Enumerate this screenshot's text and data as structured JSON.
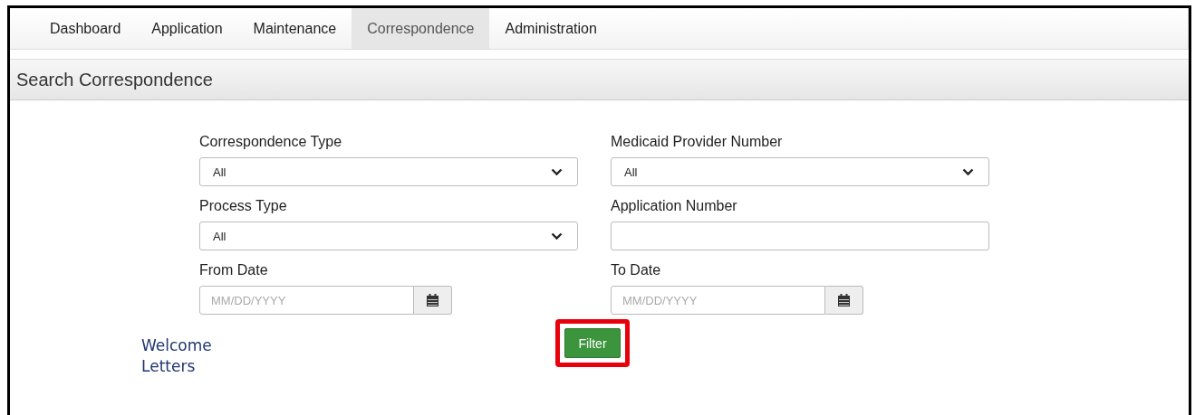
{
  "tabs": [
    {
      "label": "Dashboard",
      "selected": false
    },
    {
      "label": "Application",
      "selected": false
    },
    {
      "label": "Maintenance",
      "selected": false
    },
    {
      "label": "Correspondence",
      "selected": true
    },
    {
      "label": "Administration",
      "selected": false
    }
  ],
  "panel": {
    "title": "Search Correspondence"
  },
  "fields": [
    {
      "kind": "select",
      "label": "Correspondence Type",
      "value": "All"
    },
    {
      "kind": "select",
      "label": "Medicaid Provider Number",
      "value": "All"
    },
    {
      "kind": "select",
      "label": "Process Type",
      "value": "All"
    },
    {
      "kind": "text",
      "label": "Application Number"
    },
    {
      "kind": "date",
      "label": "From Date",
      "placeholder": "MM/DD/YYYY"
    },
    {
      "kind": "date",
      "label": "To Date",
      "placeholder": "MM/DD/YYYY"
    }
  ],
  "filter_button": {
    "label": "Filter",
    "highlighted": true
  },
  "link": "Welcome Letters"
}
